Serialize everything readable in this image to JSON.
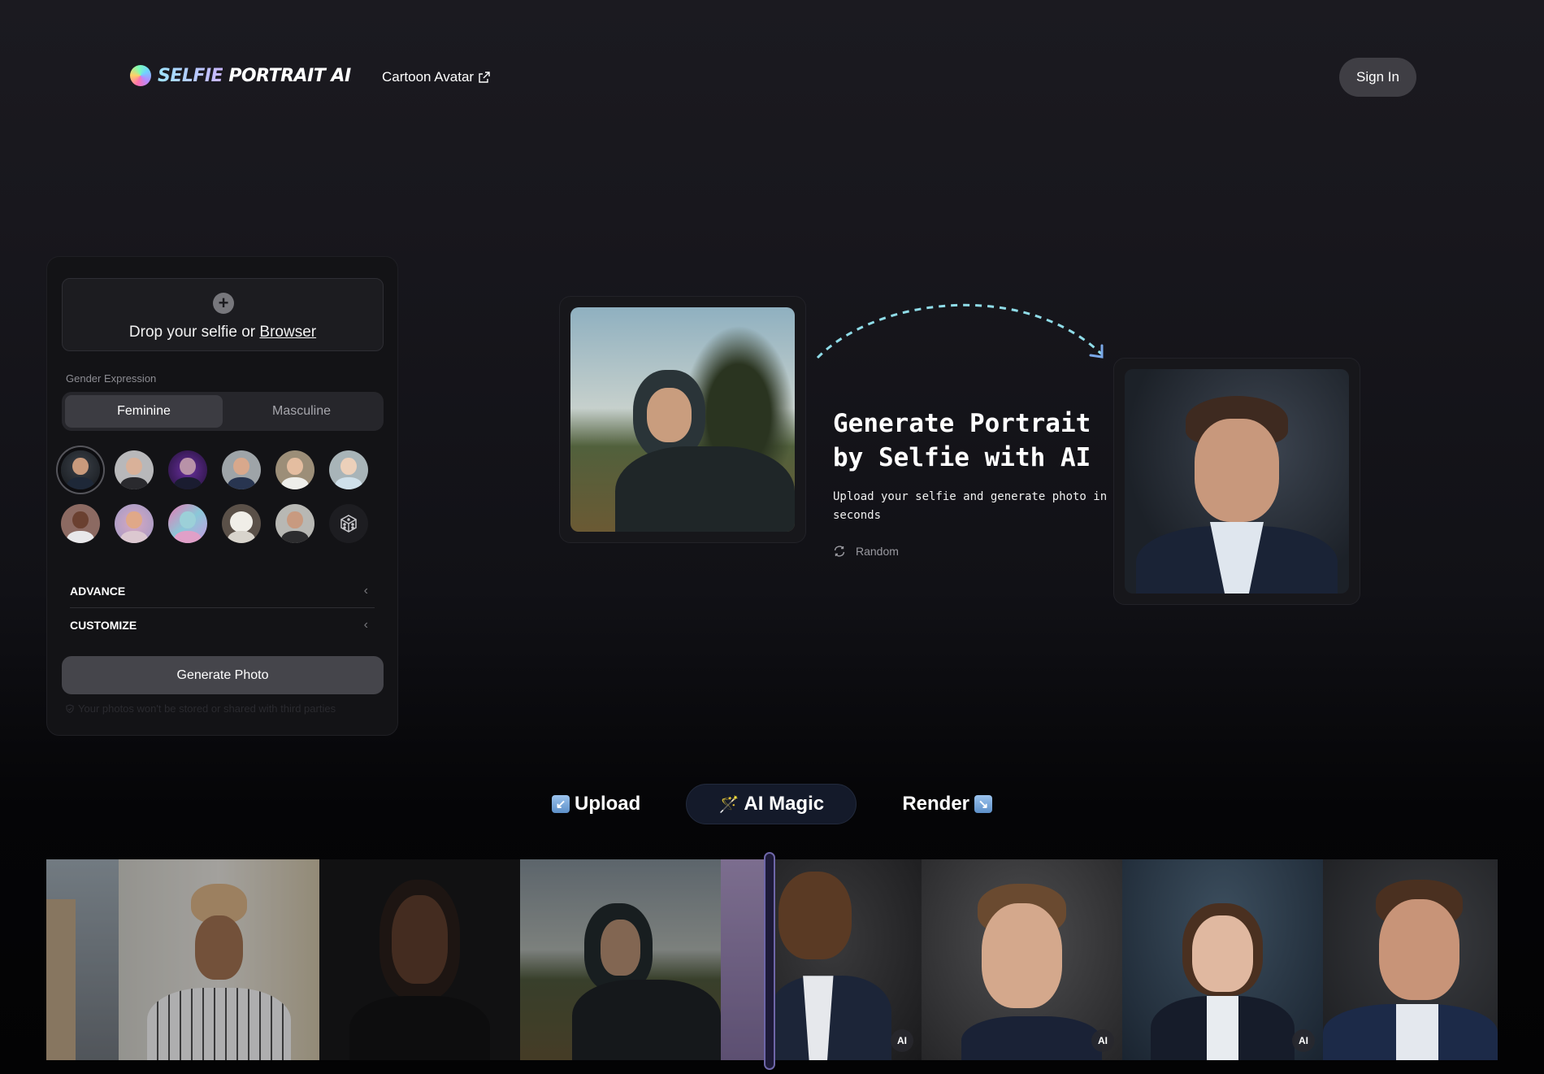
{
  "header": {
    "logo_part1": "SELFIE",
    "logo_part2": "PORTRAIT AI",
    "nav_link": "Cartoon Avatar",
    "sign_in": "Sign In"
  },
  "panel": {
    "drop_text": "Drop your selfie or ",
    "browse_link": "Browser",
    "gender_label": "Gender Expression",
    "gender_options": [
      "Feminine",
      "Masculine"
    ],
    "gender_selected": "Feminine",
    "style_presets": [
      {
        "name": "studio-man",
        "selected": true
      },
      {
        "name": "suit-man"
      },
      {
        "name": "purple-suit"
      },
      {
        "name": "press-conference"
      },
      {
        "name": "chef-woman"
      },
      {
        "name": "office-woman"
      },
      {
        "name": "athlete"
      },
      {
        "name": "pastel-portrait"
      },
      {
        "name": "holi-festival"
      },
      {
        "name": "astronaut"
      },
      {
        "name": "street-friends"
      },
      {
        "name": "random-dice"
      }
    ],
    "accordions": [
      "ADVANCE",
      "CUSTOMIZE"
    ],
    "generate_button": "Generate Photo",
    "privacy_note": "Your photos won't be stored or shared with third parties"
  },
  "hero": {
    "title": "Generate Portrait by Selfie with AI",
    "subtitle": "Upload your selfie and generate photo in seconds",
    "random_label": "Random"
  },
  "steps": [
    {
      "label": "Upload",
      "icon": "↙"
    },
    {
      "label": "AI Magic",
      "icon": "🪄"
    },
    {
      "label": "Render",
      "icon": "↘"
    }
  ],
  "gallery": {
    "ai_badge": "AI",
    "colors": {
      "accent": "#6e66a8",
      "handle_bg": "#1d1a38"
    }
  }
}
